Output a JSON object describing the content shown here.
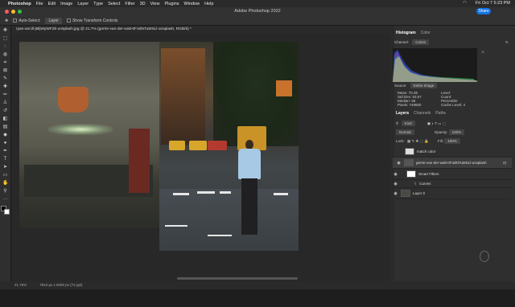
{
  "menubar": {
    "app_name": "Photoshop",
    "items": [
      "File",
      "Edit",
      "Image",
      "Layer",
      "Type",
      "Select",
      "Filter",
      "3D",
      "View",
      "Plugins",
      "Window",
      "Help"
    ],
    "clock": "Fri Oct 7  5:23 PM"
  },
  "window": {
    "title": "Adobe Photoshop 2022",
    "share_label": "Share"
  },
  "options": {
    "auto_select_label": "Auto-Select:",
    "auto_select_value": "Layer",
    "transform_label": "Show Transform Controls"
  },
  "document_tab": "ryan-ancill-j5lljWyWFZk-unsplash.jpg @ 21.7% (gerrie-van-der-walt-0F4dNTuMSLl-unsplash, RGB/8) *",
  "histogram": {
    "tabs": [
      "Histogram",
      "Color"
    ],
    "channel_label": "Channel:",
    "channel_value": "Colors",
    "source_label": "Source:",
    "source_value": "Entire Image",
    "stats_left": [
      [
        "Mean:",
        "70.35"
      ],
      [
        "Std Dev:",
        "53.57"
      ],
      [
        "Median:",
        "58"
      ],
      [
        "Pixels:",
        "749600"
      ]
    ],
    "stats_right": [
      "Level:",
      "Count:",
      "Percentile:",
      "Cache Level: 4"
    ]
  },
  "layers": {
    "tabs": [
      "Layers",
      "Channels",
      "Paths"
    ],
    "kind_label": "Kind",
    "blend_mode": "Normal",
    "opacity_label": "Opacity:",
    "opacity_value": "100%",
    "lock_label": "Lock:",
    "fill_label": "Fill:",
    "fill_value": "100%",
    "rows": [
      "match color",
      "gerrie-van-der-walt-0F4dNTuMSLl-unsplash",
      "Smart Filters",
      "Curves",
      "Layer 0"
    ]
  },
  "status": {
    "zoom": "21.76%",
    "doc_info": "7844 px x 5000 px (72 ppi)"
  },
  "colors": {
    "accent": "#1473e6",
    "panel": "#2f2f2f",
    "canvas": "#282828"
  }
}
